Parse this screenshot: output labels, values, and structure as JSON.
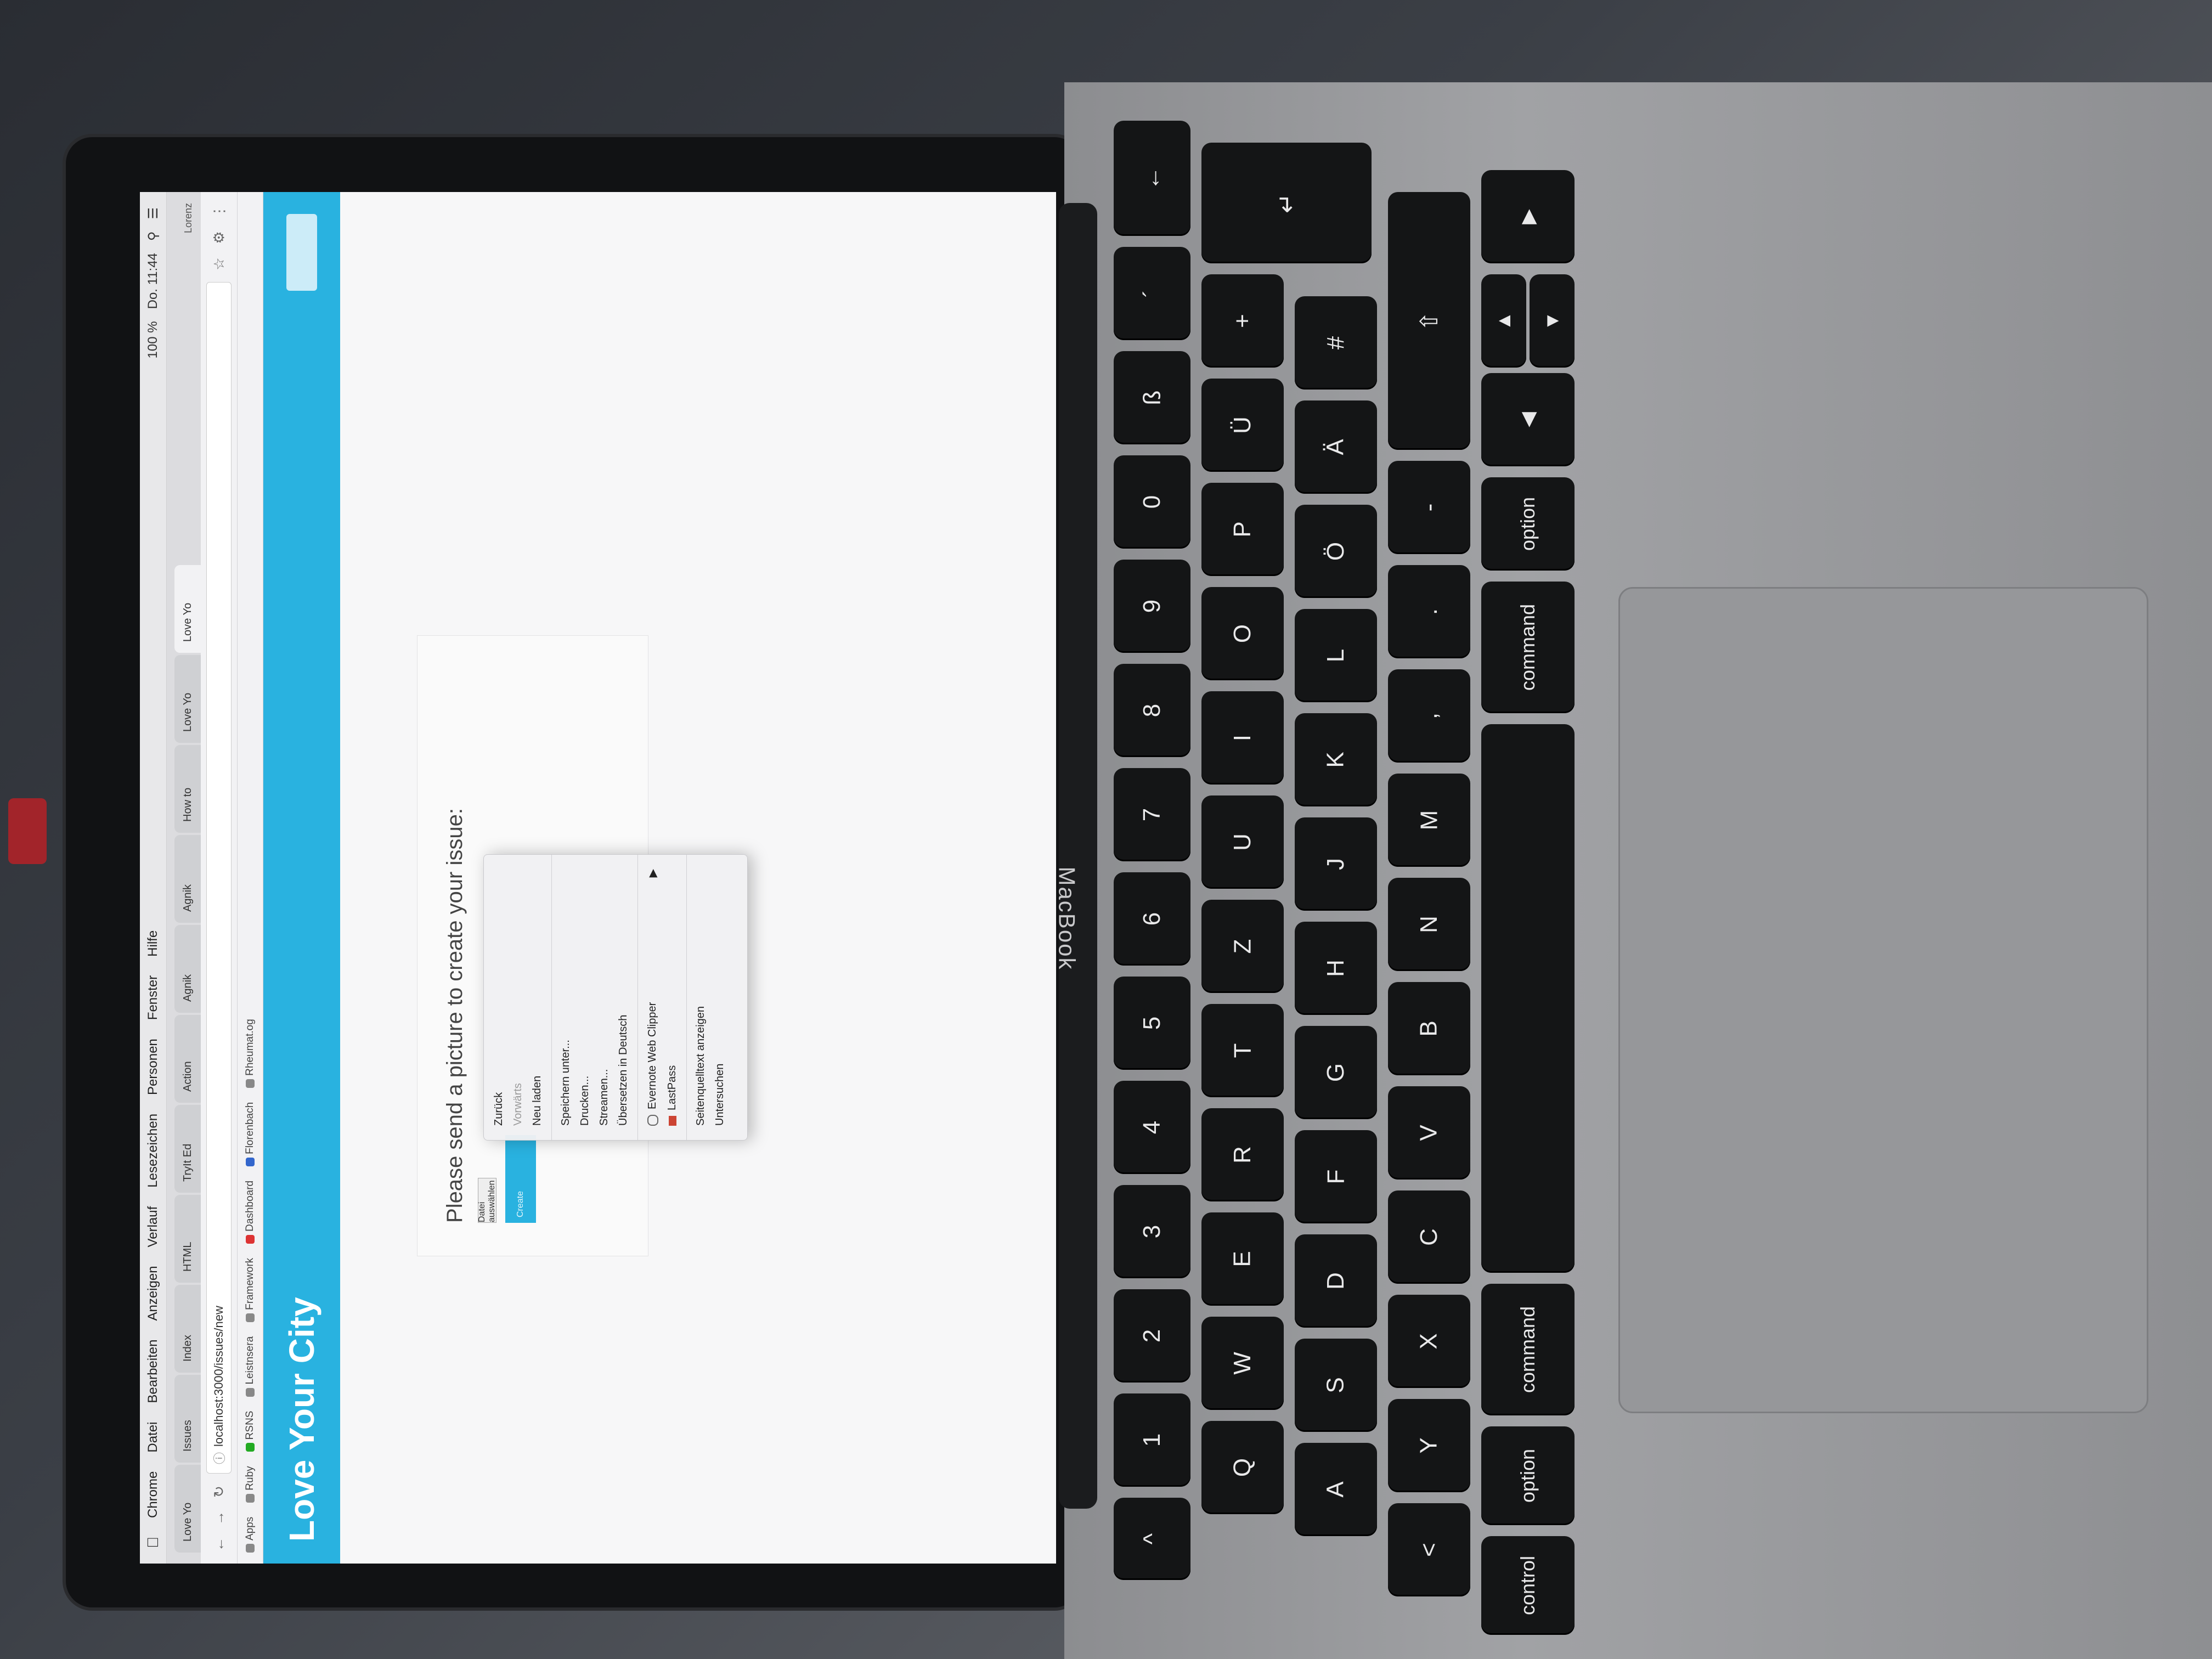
{
  "menubar": {
    "app": "Chrome",
    "items": [
      "Datei",
      "Bearbeiten",
      "Anzeigen",
      "Verlauf",
      "Lesezeichen",
      "Personen",
      "Fenster",
      "Hilfe"
    ],
    "battery": "100 %",
    "time": "Do. 11:44"
  },
  "tabs": [
    {
      "label": "Love Yo",
      "active": false
    },
    {
      "label": "Issues",
      "active": false
    },
    {
      "label": "Index",
      "active": false
    },
    {
      "label": "HTML",
      "active": false
    },
    {
      "label": "TryIt Ed",
      "active": false
    },
    {
      "label": "Action",
      "active": false
    },
    {
      "label": "Agnik",
      "active": false
    },
    {
      "label": "Agnik",
      "active": false
    },
    {
      "label": "How to",
      "active": false
    },
    {
      "label": "Love Yo",
      "active": false
    },
    {
      "label": "Love Yo",
      "active": true
    }
  ],
  "profile": "Lorenz",
  "address_bar": {
    "url": "localhost:3000/issues/new"
  },
  "bookmarks": [
    {
      "label": "Apps",
      "color": "#888"
    },
    {
      "label": "Ruby",
      "color": "#888"
    },
    {
      "label": "RSNS",
      "color": "#2a2"
    },
    {
      "label": "Leistnsera",
      "color": "#888"
    },
    {
      "label": "Framework",
      "color": "#888"
    },
    {
      "label": "Dashboard",
      "color": "#d33"
    },
    {
      "label": "Florenbach",
      "color": "#36c"
    },
    {
      "label": "Rheumat.og",
      "color": "#888"
    }
  ],
  "app": {
    "brand": "Love Your City",
    "accent": "#29b2e0"
  },
  "form": {
    "title": "Please send a picture to create your issue:",
    "file_button": "Datei auswählen",
    "submit": "Create"
  },
  "context_menu": {
    "items": [
      {
        "label": "Zurück",
        "disabled": false
      },
      {
        "label": "Vorwärts",
        "disabled": true
      },
      {
        "label": "Neu laden",
        "disabled": false
      },
      {
        "sep": true
      },
      {
        "label": "Speichern unter...",
        "disabled": false
      },
      {
        "label": "Drucken...",
        "disabled": false
      },
      {
        "label": "Streamen...",
        "disabled": false
      },
      {
        "label": "Übersetzen in Deutsch",
        "disabled": false
      },
      {
        "sep": true
      },
      {
        "label": "Evernote Web Clipper",
        "disabled": false,
        "icon": "evernote-icon",
        "submenu": true
      },
      {
        "label": "LastPass",
        "disabled": false,
        "icon": "lastpass-icon"
      },
      {
        "sep": true
      },
      {
        "label": "Seitenquelltext anzeigen",
        "disabled": false
      },
      {
        "label": "Untersuchen",
        "disabled": false
      }
    ]
  },
  "laptop": {
    "brand": "MacBook"
  },
  "keyboard": {
    "row_numbers": [
      "^",
      "1",
      "2",
      "3",
      "4",
      "5",
      "6",
      "7",
      "8",
      "9",
      "0",
      "ß",
      "´"
    ],
    "row_q": [
      "Q",
      "W",
      "E",
      "R",
      "T",
      "Z",
      "U",
      "I",
      "O",
      "P",
      "Ü",
      "+"
    ],
    "row_a": [
      "A",
      "S",
      "D",
      "F",
      "G",
      "H",
      "J",
      "K",
      "L",
      "Ö",
      "Ä",
      "#"
    ],
    "row_y": [
      "<",
      "Y",
      "X",
      "C",
      "V",
      "B",
      "N",
      "M",
      ",",
      ".",
      "-"
    ],
    "bottom": [
      "control",
      "option",
      "command",
      "",
      "command",
      "option"
    ]
  }
}
